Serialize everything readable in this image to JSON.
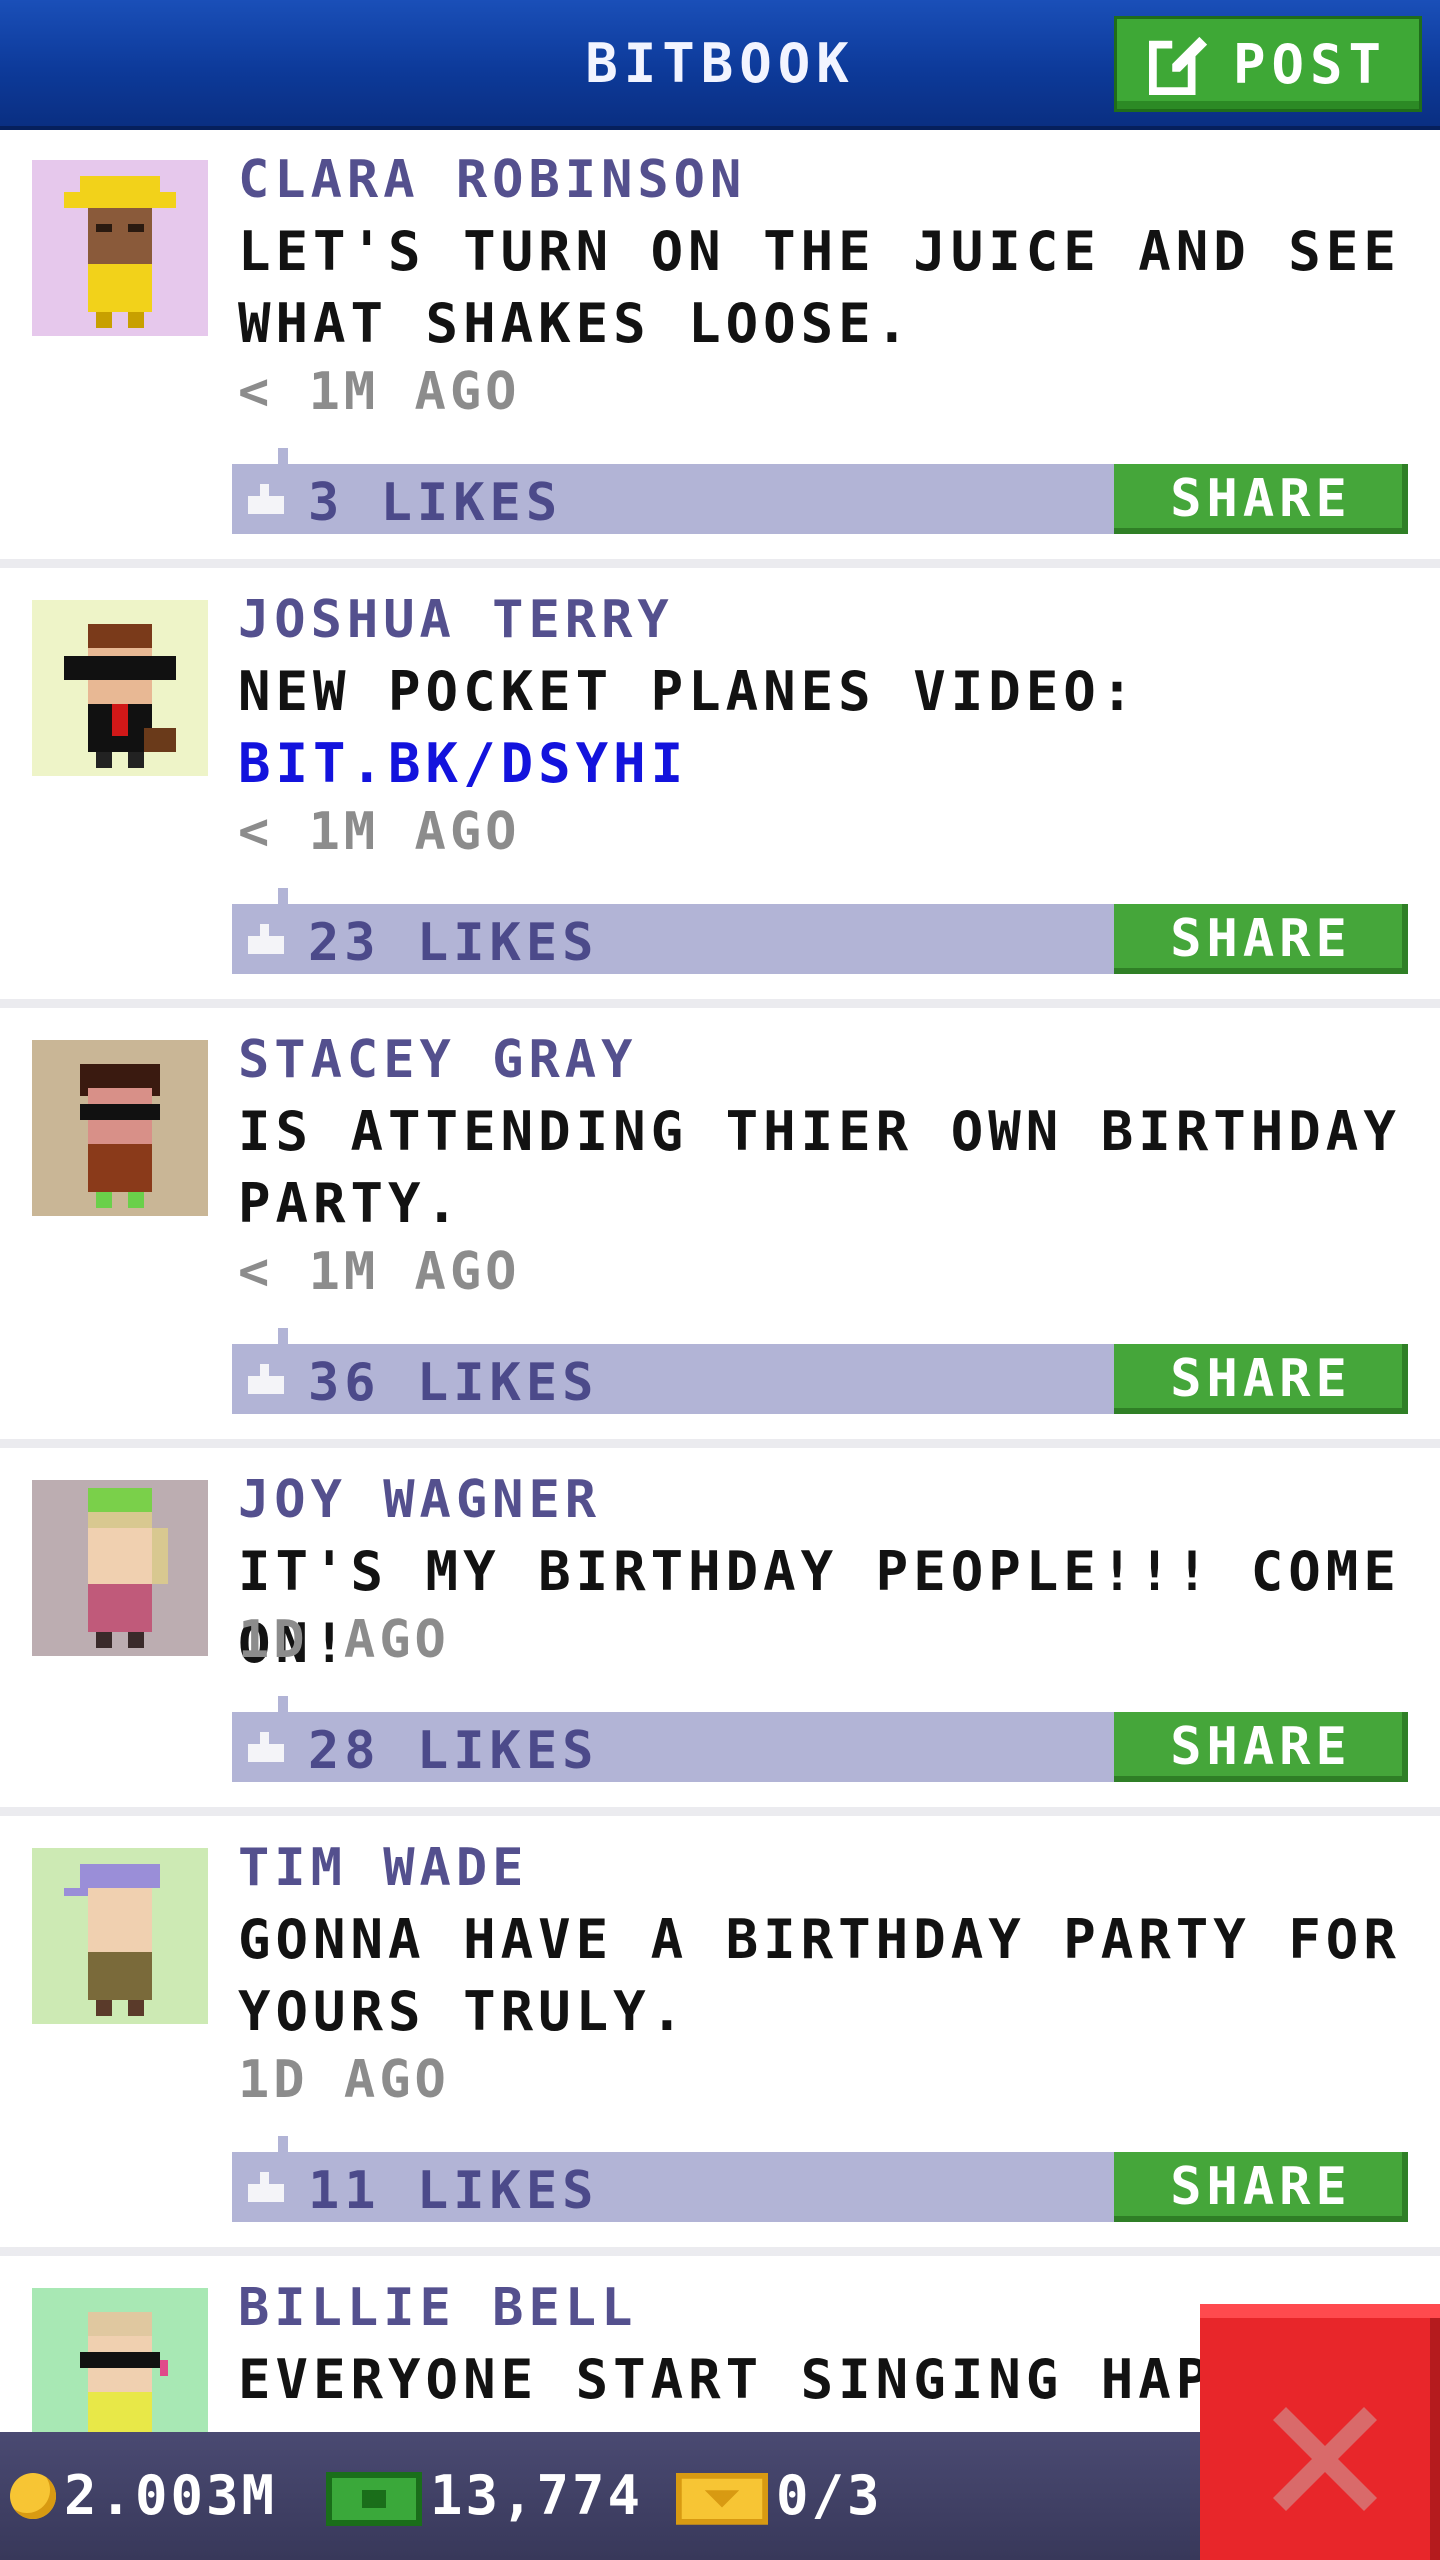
{
  "header": {
    "title": "BITBOOK",
    "post_label": "POST"
  },
  "posts": [
    {
      "name": "CLARA ROBINSON",
      "text": "LET'S TURN ON THE JUICE AND SEE WHAT SHAKES LOOSE.",
      "link": "",
      "time": "< 1M AGO",
      "likes": "3 LIKES",
      "share": "SHARE",
      "avatar_bg": "#e6c8ec"
    },
    {
      "name": "JOSHUA TERRY",
      "text": "NEW POCKET PLANES VIDEO:",
      "link": "BIT.BK/DSYHI",
      "time": "< 1M AGO",
      "likes": "23 LIKES",
      "share": "SHARE",
      "avatar_bg": "#eef4c8"
    },
    {
      "name": "STACEY GRAY",
      "text": "IS ATTENDING THIER OWN BIRTHDAY PARTY.",
      "link": "",
      "time": "< 1M AGO",
      "likes": "36 LIKES",
      "share": "SHARE",
      "avatar_bg": "#c9b696"
    },
    {
      "name": "JOY WAGNER",
      "text": "IT'S MY BIRTHDAY PEOPLE!!! COME ON!",
      "link": "",
      "time": "1D AGO",
      "likes": "28 LIKES",
      "share": "SHARE",
      "avatar_bg": "#bcadb1"
    },
    {
      "name": "TIM WADE",
      "text": "GONNA HAVE A BIRTHDAY PARTY FOR YOURS TRULY.",
      "link": "",
      "time": "1D AGO",
      "likes": "11 LIKES",
      "share": "SHARE",
      "avatar_bg": "#cdeab4"
    },
    {
      "name": "BILLIE BELL",
      "text": "EVERYONE START SINGING HAPP",
      "link": "",
      "time": "",
      "likes": "",
      "share": "",
      "avatar_bg": "#a8e8b4"
    }
  ],
  "bottom_bar": {
    "coins": "2.003M",
    "bux": "13,774",
    "tickets": "0/3"
  },
  "colors": {
    "header": "#0d3a9a",
    "post_button": "#3ea836",
    "likes_bar": "#b2b4d6",
    "share_button": "#45a63a",
    "name": "#54508e",
    "link": "#1313dd",
    "close_button": "#e8262a"
  },
  "icons": {
    "post": "edit-icon",
    "like": "thumbs-up-icon",
    "coin": "coin-icon",
    "bux": "bux-icon",
    "ticket": "ticket-icon",
    "close": "close-x-icon"
  }
}
